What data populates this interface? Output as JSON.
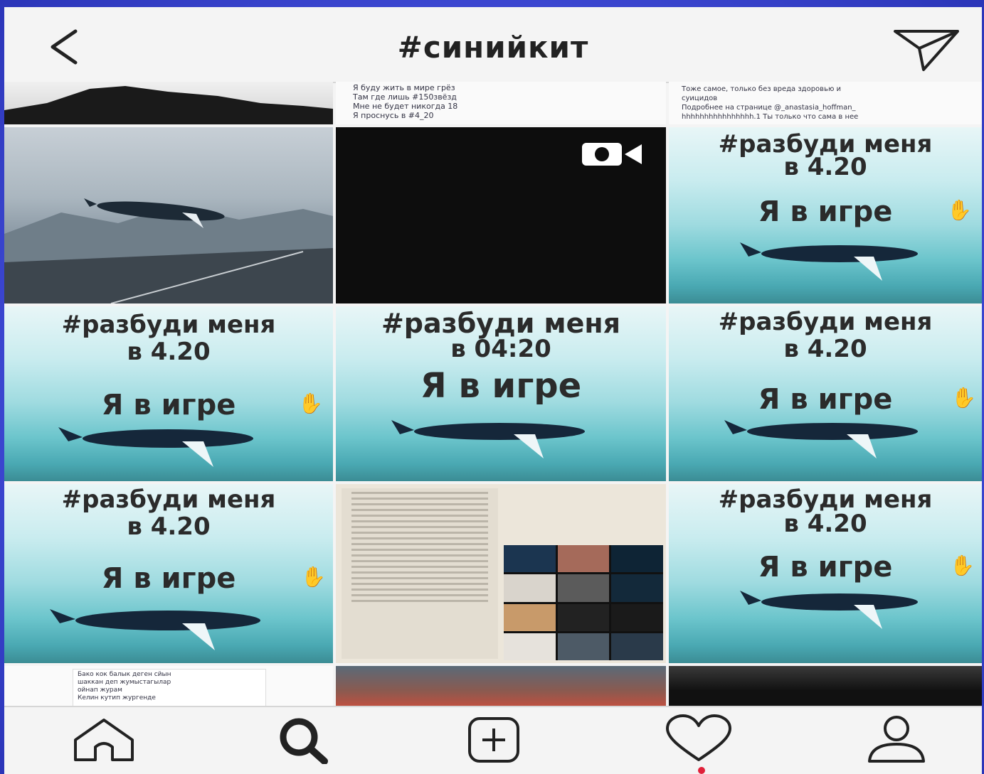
{
  "header": {
    "title": "#синийкит",
    "back_icon": "chevron-left-icon",
    "send_icon": "paper-plane-icon"
  },
  "posts": {
    "r0c2_caption": [
      "Я буду жить в мире грёз",
      "Там где лишь #150звёзд",
      "Мне не будет никогда 18",
      "Я проснусь в #4_20"
    ],
    "r0c3_caption": [
      "Тоже самое, только без вреда здоровью и",
      "суицидов",
      "Подробнее на странице @_anastasia_hoffman_",
      "hhhhhhhhhhhhhhhh.1 Ты только что сама в нее"
    ],
    "r1c3": {
      "hash": "#разбуди меня",
      "time": "в 4.20",
      "game": "Я в игре"
    },
    "r2c1": {
      "hash": "#разбуди меня",
      "time": "в 4.20",
      "game": "Я в игре"
    },
    "r2c2": {
      "hash": "#разбуди меня",
      "time": "в 04:20",
      "game": "Я в игре"
    },
    "r2c3": {
      "hash": "#разбуди меня",
      "time": "в 4.20",
      "game": "Я в игре"
    },
    "r3c1": {
      "hash": "#разбуди меня",
      "time": "в 4.20",
      "game": "Я в игре"
    },
    "r3c3": {
      "hash": "#разбуди меня",
      "time": "в 4.20",
      "game": "Я в игре"
    },
    "r4c1_caption": [
      "Бако кок балык деген сйын",
      "шаккан деп жумыстагылар",
      "ойнап журам",
      "Келин кутип жургенде"
    ],
    "video_icon": "video-camera-icon"
  },
  "nav": {
    "home_icon": "home-icon",
    "search_icon": "search-icon",
    "add_icon": "add-post-icon",
    "activity_icon": "heart-icon",
    "profile_icon": "profile-icon"
  },
  "colors": {
    "slide_bg": "#4a55d8",
    "screen_bg": "#f4f4f4",
    "notification": "#e0213a"
  }
}
